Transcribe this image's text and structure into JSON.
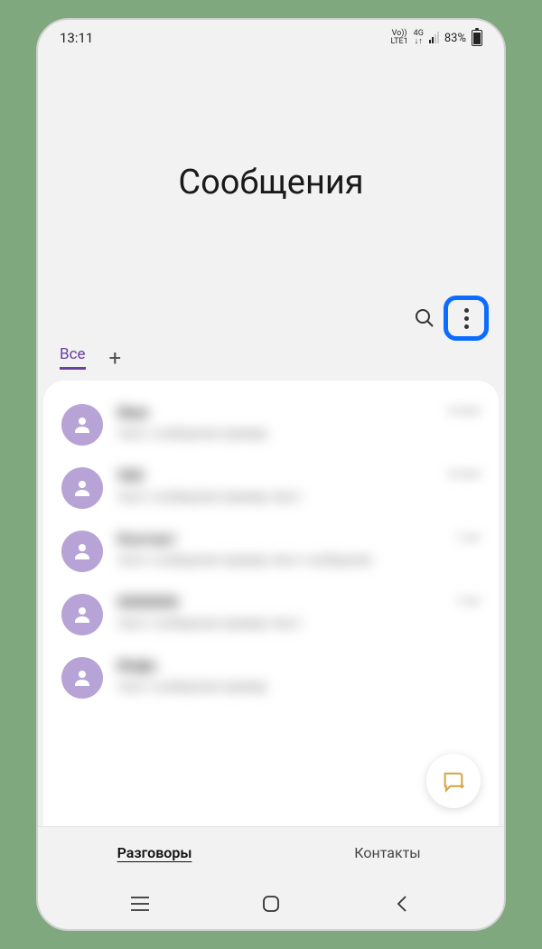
{
  "status": {
    "time": "13:11",
    "volte_line1": "Vo))",
    "volte_line2": "LTE1",
    "network": "4G",
    "arrows": "↓↑",
    "battery_pct": "83%"
  },
  "header": {
    "title": "Сообщения"
  },
  "tabs_top": {
    "all_label": "Все",
    "add_label": "+"
  },
  "conversations": [
    {
      "name": "Имя",
      "preview": "текст сообщения пример",
      "time": "вчера"
    },
    {
      "name": "900",
      "preview": "текст сообщения пример текст",
      "time": "вчера"
    },
    {
      "name": "Контакт",
      "preview": "текст сообщения пример текст сообщения",
      "time": "2 дн"
    },
    {
      "name": "0000000",
      "preview": "текст сообщения пример текст",
      "time": "3 дн"
    },
    {
      "name": "Инфо",
      "preview": "текст сообщения пример",
      "time": ""
    }
  ],
  "bottom_tabs": {
    "conversations_label": "Разговоры",
    "contacts_label": "Контакты"
  }
}
